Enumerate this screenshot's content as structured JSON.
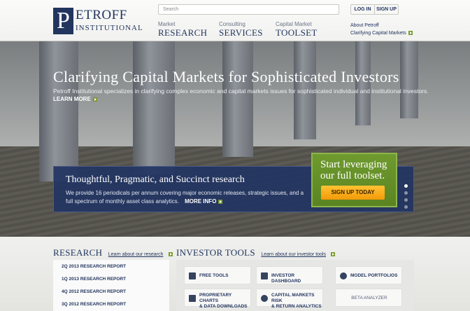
{
  "header": {
    "logo_letter": "P",
    "logo_line1": "ETROFF",
    "logo_line2": "INSTITUTIONAL",
    "search_placeholder": "Search",
    "login_label": "LOG IN",
    "signup_label": "SIGN UP",
    "nav": [
      {
        "small": "Market",
        "big": "RESEARCH"
      },
      {
        "small": "Consulting",
        "big": "SERVICES"
      },
      {
        "small": "Capital Market",
        "big": "TOOLSET"
      }
    ],
    "side_links": [
      "About Petroff",
      "Clarifying Capital Markets"
    ]
  },
  "hero": {
    "title": "Clarifying Capital Markets for Sophisticated Investors",
    "subtitle": "Petroff Institutional specializes in clarifying complex economic and capital markets issues for sophisticated individual and institutional investors.",
    "learn_more": "LEARN MORE",
    "panel_title": "Thoughtful, Pragmatic, and Succinct research",
    "panel_text": "We provide 16 periodicals per annum covering major economic releases, strategic issues, and a full spectrum of monthly asset class analytics.",
    "panel_more": "MORE INFO",
    "cta_title_line1": "Start leveraging",
    "cta_title_line2": "our full toolset.",
    "cta_button": "SIGN UP TODAY",
    "slide_count": 4,
    "active_slide": 1
  },
  "research": {
    "heading": "RESEARCH",
    "link": "Learn about our research",
    "items": [
      "2Q 2013 RESEARCH REPORT",
      "1Q 2013 RESEARCH REPORT",
      "4Q 2012 RESEARCH REPORT",
      "3Q 2012 RESEARCH REPORT"
    ]
  },
  "investor_tools": {
    "heading": "INVESTOR TOOLS",
    "link": "Learn about our investor tools",
    "tools": [
      {
        "line1": "FREE TOOLS",
        "line2": "",
        "icon": "tools-icon"
      },
      {
        "line1": "INVESTOR DASHBOARD",
        "line2": "",
        "icon": "dashboard-icon"
      },
      {
        "line1": "MODEL PORTFOLIOS",
        "line2": "",
        "icon": "database-icon"
      },
      {
        "line1": "PROPRIETARY CHARTS",
        "line2": "& DATA DOWNLOADS",
        "icon": "chart-icon"
      },
      {
        "line1": "CAPITAL MARKETS RISK",
        "line2": "& RETURN ANALYTICS",
        "icon": "pie-chart-icon"
      },
      {
        "line1": "BETA ANALYZER",
        "line2": "",
        "icon": ""
      }
    ]
  },
  "colors": {
    "brand_navy": "#22355f",
    "accent_green": "#7a9a2a",
    "cta_orange": "#f6a818"
  }
}
